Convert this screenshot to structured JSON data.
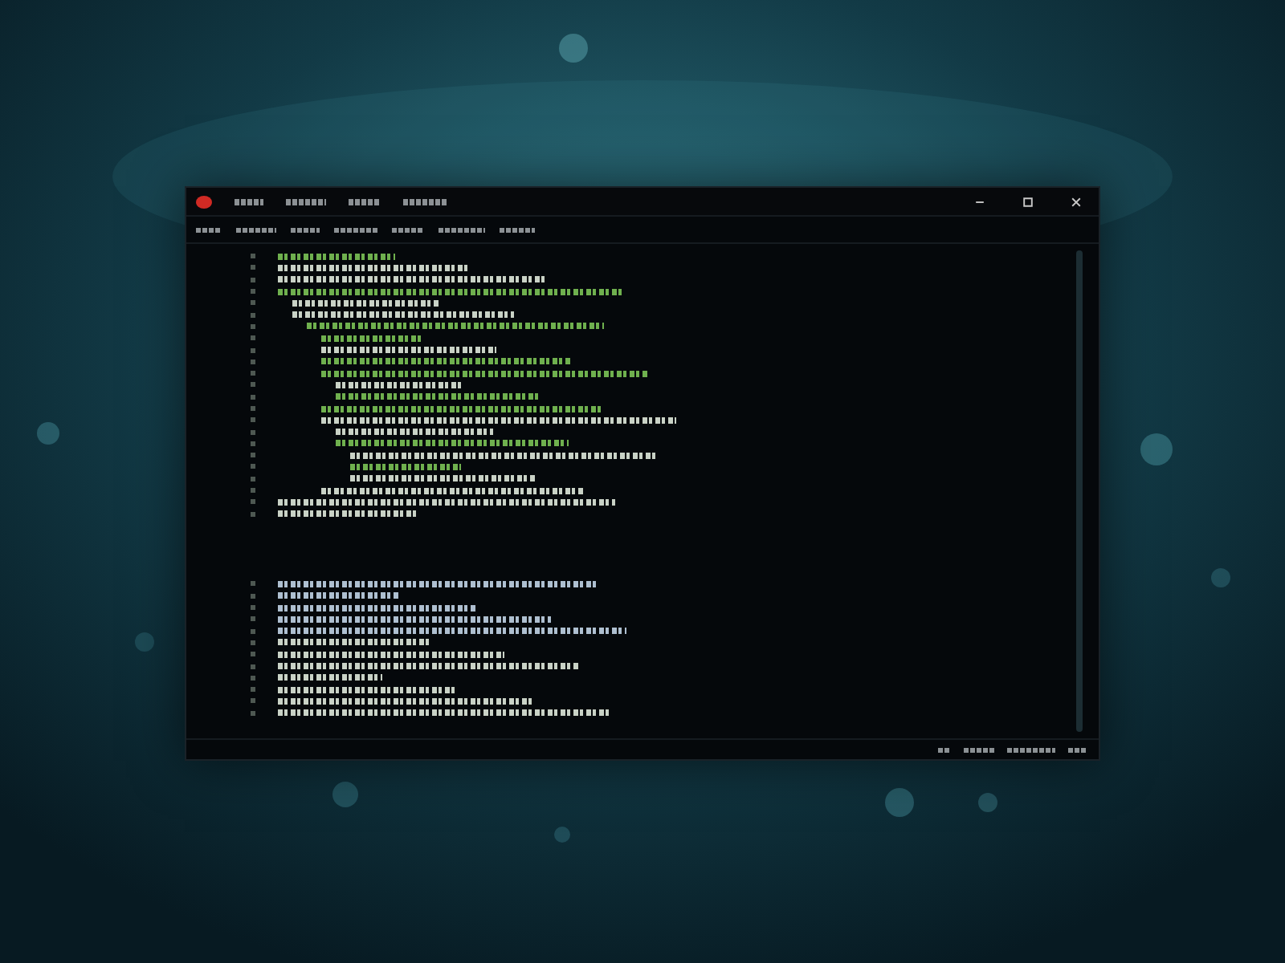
{
  "window": {
    "app_mark": {
      "kind": "logo",
      "color": "#d02a24"
    },
    "menu_items": [
      {
        "kind": "illegible"
      },
      {
        "kind": "illegible"
      },
      {
        "kind": "illegible"
      },
      {
        "kind": "illegible"
      }
    ],
    "controls": [
      {
        "kind": "minimize"
      },
      {
        "kind": "maximize"
      },
      {
        "kind": "close"
      }
    ]
  },
  "toolbar": {
    "items": [
      {
        "kind": "illegible"
      },
      {
        "kind": "illegible"
      },
      {
        "kind": "illegible"
      },
      {
        "kind": "illegible"
      },
      {
        "kind": "illegible"
      },
      {
        "kind": "illegible"
      },
      {
        "kind": "illegible"
      }
    ]
  },
  "editor": {
    "lines": [
      {
        "kind": "code",
        "color": "#6fb04e"
      },
      {
        "kind": "code",
        "color": "#c9d2c6"
      },
      {
        "kind": "code",
        "color": "#c9d2c6"
      },
      {
        "kind": "code",
        "color": "#6fb04e",
        "children": [
          {
            "kind": "code",
            "color": "#c9d2c6"
          },
          {
            "kind": "code",
            "color": "#c9d2c6",
            "children": [
              {
                "kind": "code",
                "color": "#6fb04e",
                "children": [
                  {
                    "kind": "code",
                    "color": "#6fb04e"
                  },
                  {
                    "kind": "code",
                    "color": "#c9d2c6"
                  },
                  {
                    "kind": "code",
                    "color": "#6fb04e"
                  },
                  {
                    "kind": "code",
                    "color": "#6fb04e",
                    "children": [
                      {
                        "kind": "code",
                        "color": "#c9d2c6"
                      },
                      {
                        "kind": "code",
                        "color": "#6fb04e"
                      }
                    ]
                  },
                  {
                    "kind": "code",
                    "color": "#6fb04e"
                  },
                  {
                    "kind": "code",
                    "color": "#c9d2c6",
                    "children": [
                      {
                        "kind": "code",
                        "color": "#c9d2c6"
                      },
                      {
                        "kind": "code",
                        "color": "#6fb04e",
                        "children": [
                          {
                            "kind": "code",
                            "color": "#c9d2c6"
                          },
                          {
                            "kind": "code",
                            "color": "#6fb04e"
                          },
                          {
                            "kind": "code",
                            "color": "#c9d2c6"
                          }
                        ]
                      }
                    ]
                  },
                  {
                    "kind": "code",
                    "color": "#c9d2c6"
                  }
                ]
              }
            ]
          }
        ]
      },
      {
        "kind": "code",
        "color": "#c9d2c6"
      },
      {
        "kind": "code",
        "color": "#c9d2c6"
      },
      {
        "kind": "blank"
      },
      {
        "kind": "blank"
      },
      {
        "kind": "blank"
      },
      {
        "kind": "blank"
      },
      {
        "kind": "blank"
      },
      {
        "kind": "code",
        "color": "#aebfd0"
      },
      {
        "kind": "code",
        "color": "#aebfd0"
      },
      {
        "kind": "code",
        "color": "#aebfd0"
      },
      {
        "kind": "code",
        "color": "#aebfd0"
      },
      {
        "kind": "code",
        "color": "#aebfd0"
      },
      {
        "kind": "code",
        "color": "#c9d2c6"
      },
      {
        "kind": "code",
        "color": "#c9d2c6"
      },
      {
        "kind": "code",
        "color": "#c9d2c6"
      },
      {
        "kind": "code",
        "color": "#c9d2c6"
      },
      {
        "kind": "code",
        "color": "#c9d2c6"
      },
      {
        "kind": "code",
        "color": "#c9d2c6"
      },
      {
        "kind": "code",
        "color": "#c9d2c6"
      }
    ]
  },
  "status_bar": {
    "items": [
      {
        "kind": "illegible"
      },
      {
        "kind": "illegible"
      },
      {
        "kind": "illegible"
      },
      {
        "kind": "illegible"
      }
    ]
  }
}
